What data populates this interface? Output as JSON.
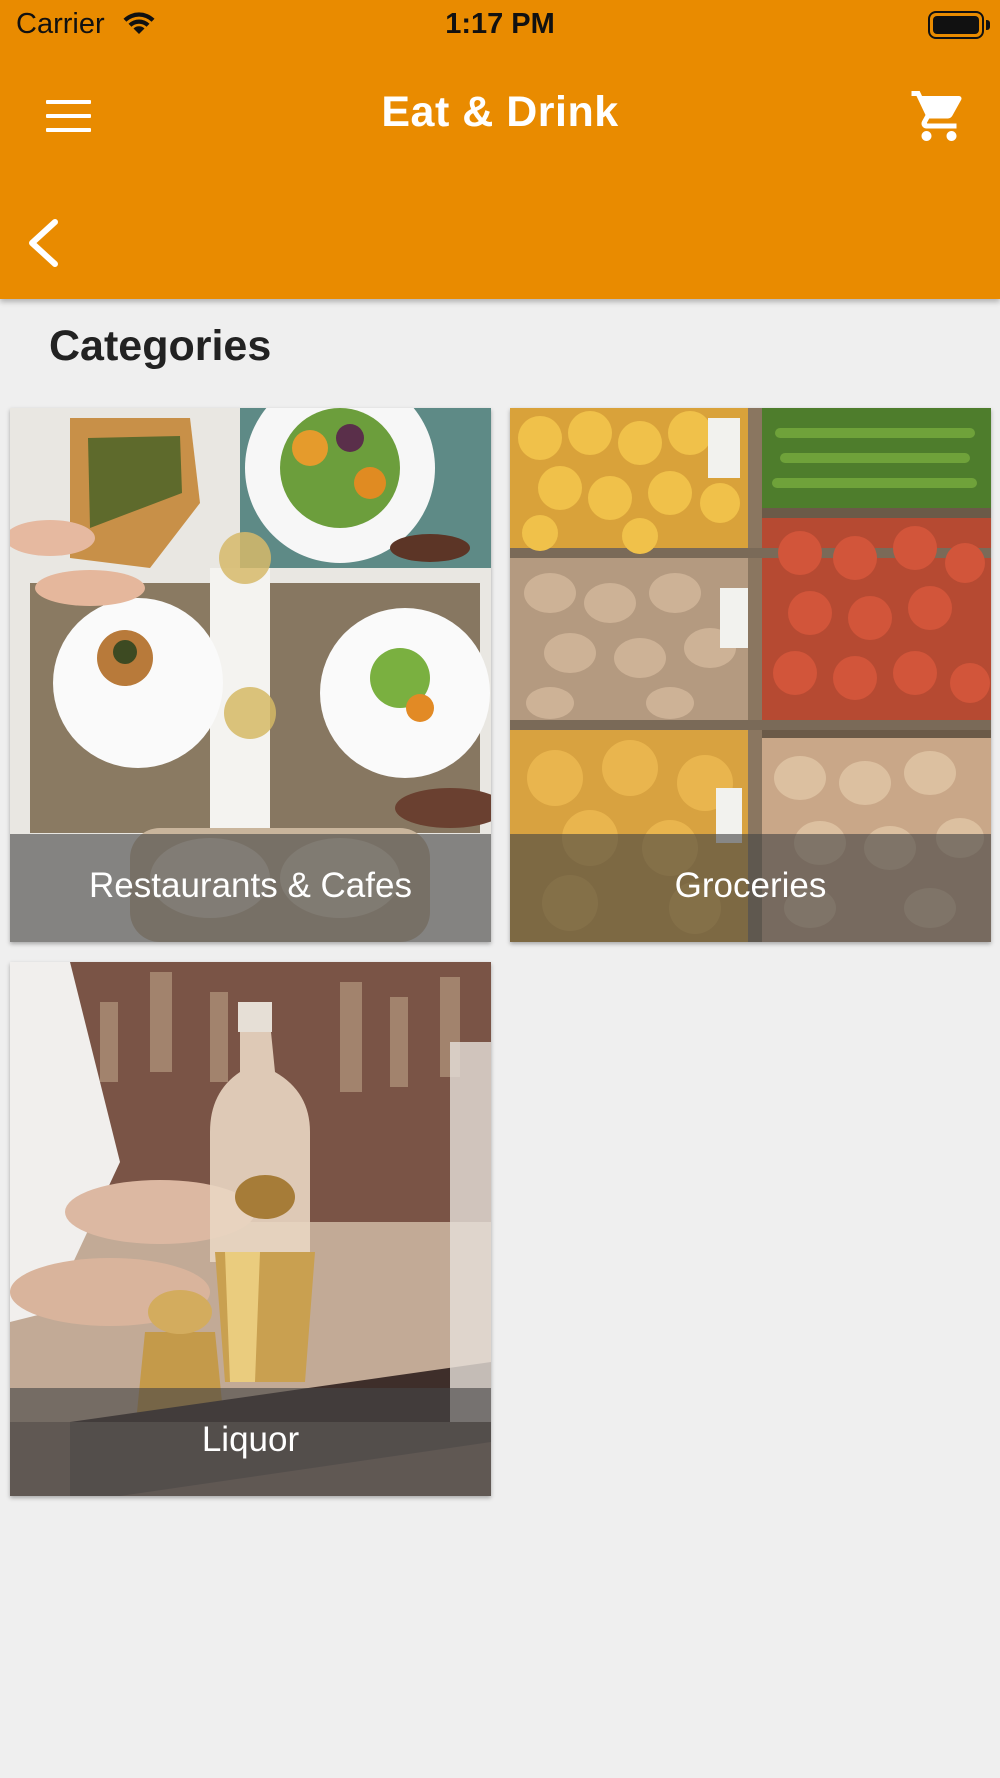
{
  "status_bar": {
    "carrier": "Carrier",
    "time": "1:17 PM"
  },
  "app_bar": {
    "title": "Eat & Drink",
    "icons": [
      "menu-icon",
      "cart-icon",
      "back-chevron-icon"
    ]
  },
  "section": {
    "heading": "Categories"
  },
  "categories": [
    {
      "label": "Restaurants & Cafes",
      "image": "table-with-plated-food-photo"
    },
    {
      "label": "Groceries",
      "image": "market-produce-crates-photo"
    },
    {
      "label": "Liquor",
      "image": "bartender-pouring-drink-photo"
    }
  ],
  "colors": {
    "accent": "#e98b00",
    "background": "#efefef",
    "caption_overlay": "#464646"
  }
}
